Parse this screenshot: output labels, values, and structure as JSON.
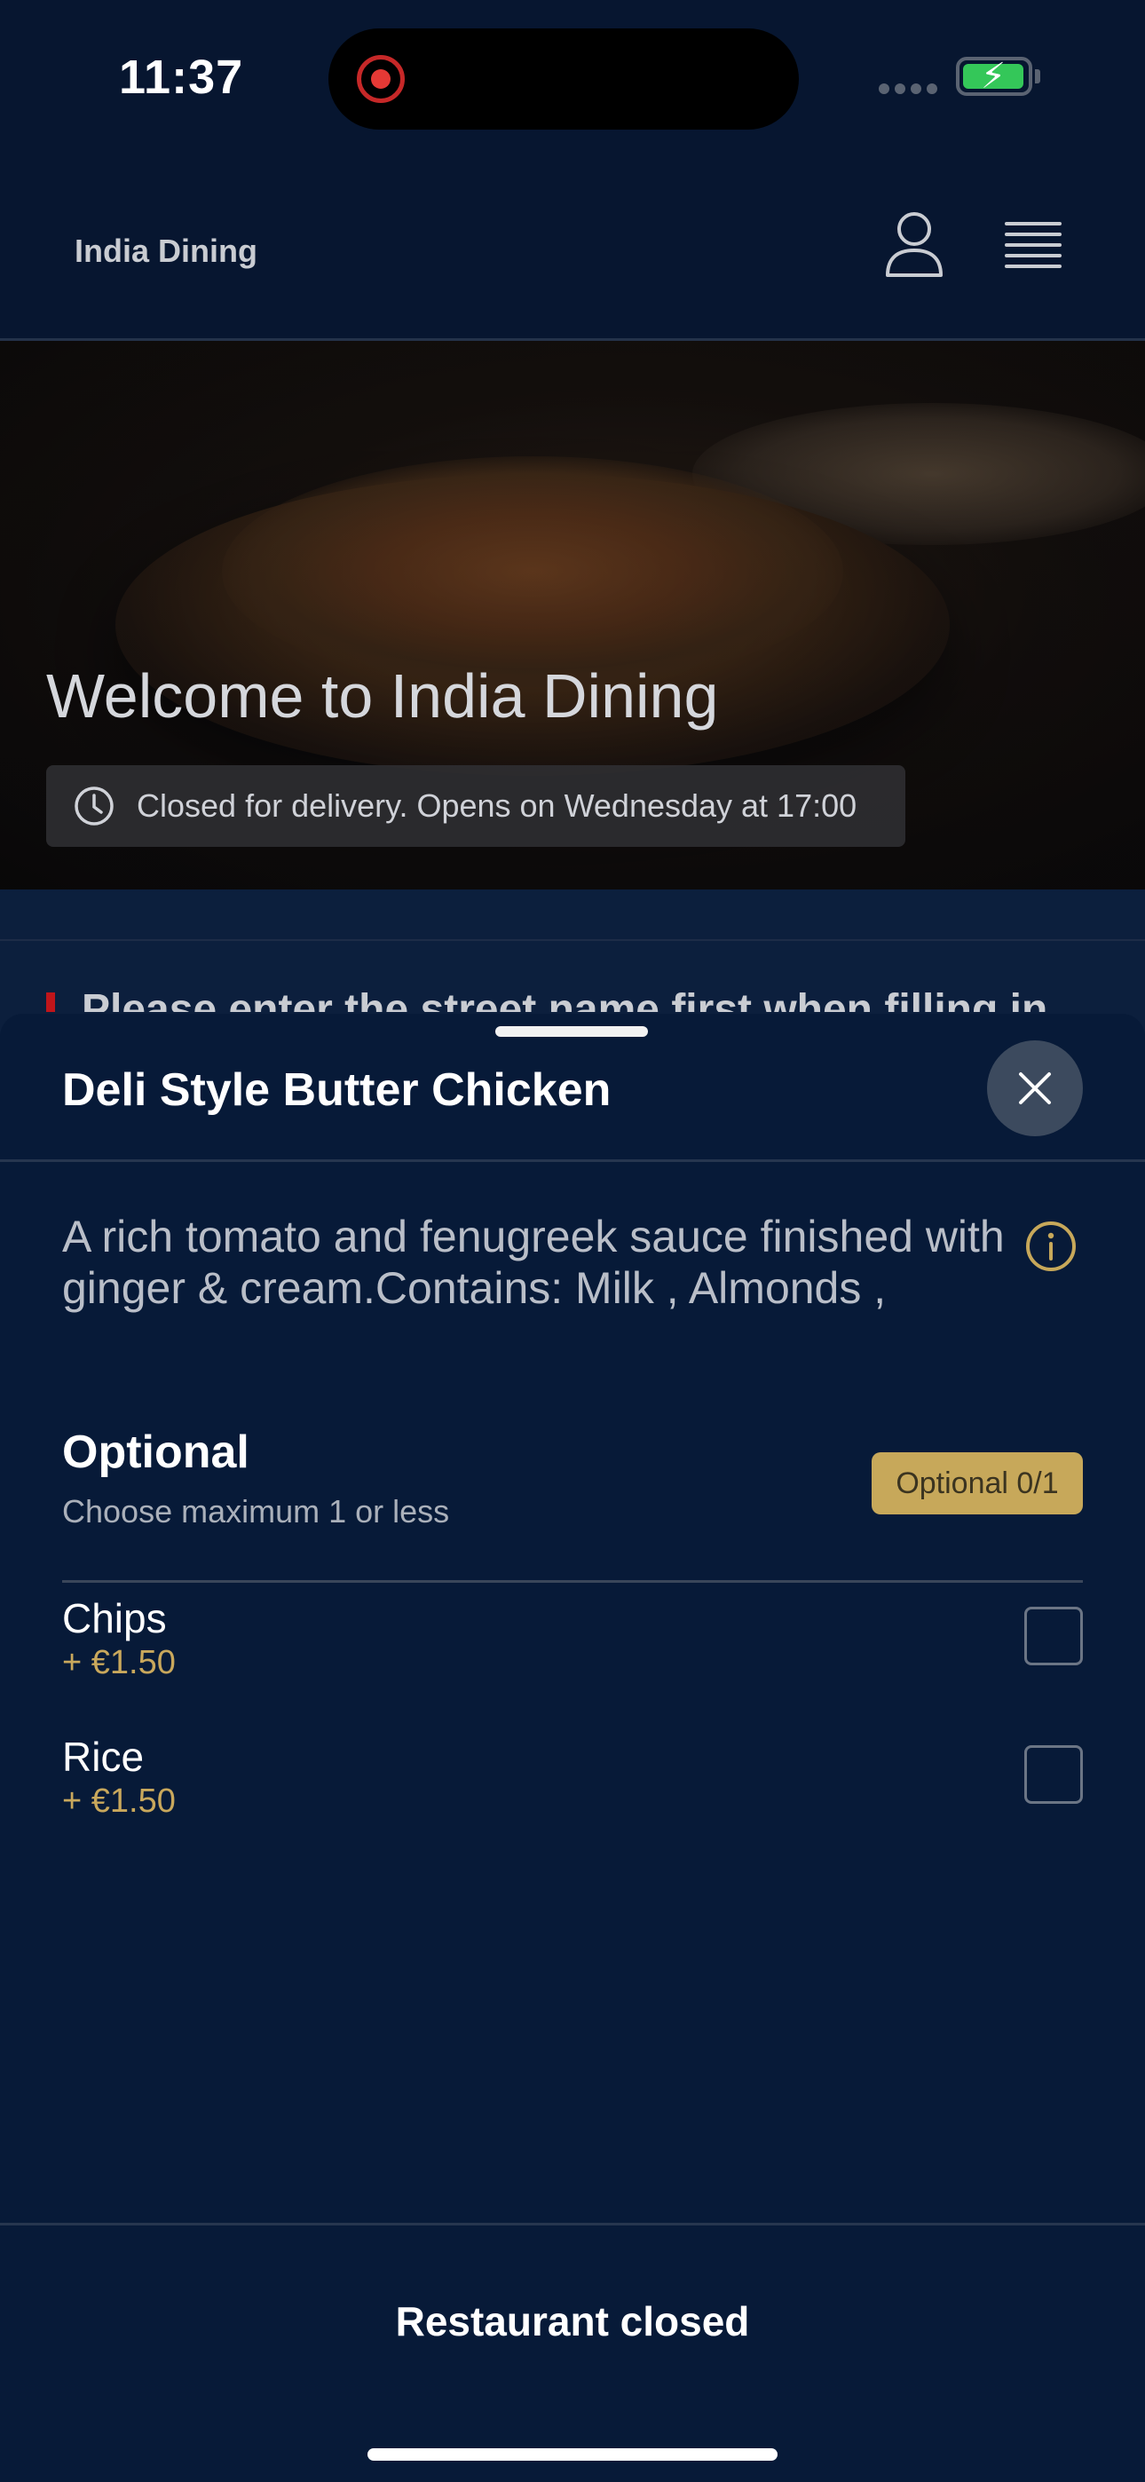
{
  "status_bar": {
    "time": "11:37"
  },
  "header": {
    "brand": "India Dining"
  },
  "hero": {
    "title": "Welcome to India Dining",
    "status": "Closed for delivery. Opens on Wednesday at 17:00"
  },
  "notice": {
    "text": "Please enter the street name first when filling in"
  },
  "sheet": {
    "title": "Deli Style Butter Chicken",
    "description": "A rich tomato and fenugreek sauce finished with ginger & cream.Contains: Milk , Almonds ,",
    "optional": {
      "title": "Optional",
      "subtitle": "Choose maximum 1 or less",
      "badge": "Optional 0/1",
      "items": [
        {
          "name": "Chips",
          "price": "+ €1.50",
          "checked": false
        },
        {
          "name": "Rice",
          "price": "+ €1.50",
          "checked": false
        }
      ]
    },
    "footer_button": "Restaurant closed"
  },
  "colors": {
    "background": "#0c1f3d",
    "accent_gold": "#c7a85a",
    "notice_red": "#c0151a"
  }
}
